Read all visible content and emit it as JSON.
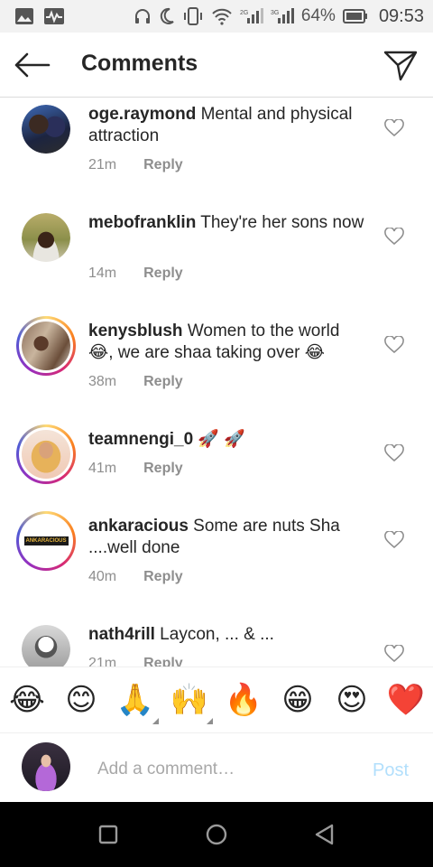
{
  "status_bar": {
    "battery_percent": "64%",
    "time": "09:53",
    "icons": [
      "gallery-icon",
      "activity-icon",
      "headphones-icon",
      "moon-icon",
      "vibrate-icon",
      "wifi-icon",
      "signal-icon",
      "signal-icon",
      "battery-icon"
    ]
  },
  "header": {
    "title": "Comments",
    "back_icon": "back-arrow-icon",
    "send_icon": "paper-plane-icon"
  },
  "comments": [
    {
      "username": "oge.raymond",
      "text": " Mental and physical attraction",
      "time": "21m",
      "reply": "Reply",
      "story_ring": false
    },
    {
      "username": "mebofranklin",
      "text": " They're her sons now",
      "time": "14m",
      "reply": "Reply",
      "story_ring": false
    },
    {
      "username": "kenysblush",
      "text": " Women to the world 😂, we are shaa taking over 😂",
      "time": "38m",
      "reply": "Reply",
      "story_ring": true
    },
    {
      "username": "teamnengi_0",
      "text": " 🚀 🚀",
      "time": "41m",
      "reply": "Reply",
      "story_ring": true
    },
    {
      "username": "ankaracious",
      "text": " Some are nuts Sha ....well done",
      "time": "40m",
      "reply": "Reply",
      "story_ring": true,
      "avatar_text": "ANKARACIOUS"
    },
    {
      "username": "nath4rill",
      "text": " Laycon, ... & ...",
      "time": "21m",
      "reply": "Reply",
      "story_ring": false
    }
  ],
  "emoji_bar": [
    "😂",
    "😊",
    "🙏",
    "🙌",
    "🔥",
    "😁",
    "😍",
    "❤️"
  ],
  "composer": {
    "placeholder": "Add a comment…",
    "post_label": "Post"
  },
  "colors": {
    "text": "#262626",
    "secondary": "#8e8e8e",
    "post_disabled": "#b2dffc",
    "divider": "#dbdbdb"
  }
}
